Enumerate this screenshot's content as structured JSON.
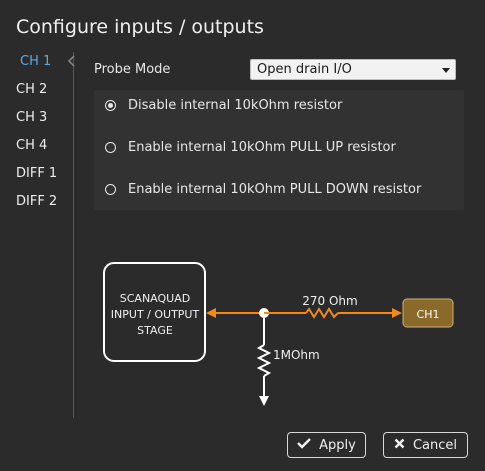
{
  "dialog": {
    "title": "Configure inputs / outputs"
  },
  "tabs": [
    {
      "label": "CH 1",
      "active": true
    },
    {
      "label": "CH 2",
      "active": false
    },
    {
      "label": "CH 3",
      "active": false
    },
    {
      "label": "CH 4",
      "active": false
    },
    {
      "label": "DIFF 1",
      "active": false
    },
    {
      "label": "DIFF 2",
      "active": false
    }
  ],
  "probe": {
    "label": "Probe Mode",
    "selected": "Open drain I/O"
  },
  "options": [
    {
      "label": "Disable internal 10kOhm resistor",
      "checked": true
    },
    {
      "label": "Enable internal 10kOhm PULL UP resistor",
      "checked": false
    },
    {
      "label": "Enable internal 10kOhm PULL DOWN resistor",
      "checked": false
    }
  ],
  "diagram": {
    "stage_line1": "SCANAQUAD",
    "stage_line2": "INPUT / OUTPUT",
    "stage_line3": "STAGE",
    "series_resistor": "270 Ohm",
    "pulldown_resistor": "1MOhm",
    "channel_label": "CH1",
    "colors": {
      "wire": "#f08a1e",
      "channel": "#8a6a2a",
      "line": "#ffffff"
    }
  },
  "buttons": {
    "apply": "Apply",
    "cancel": "Cancel"
  }
}
